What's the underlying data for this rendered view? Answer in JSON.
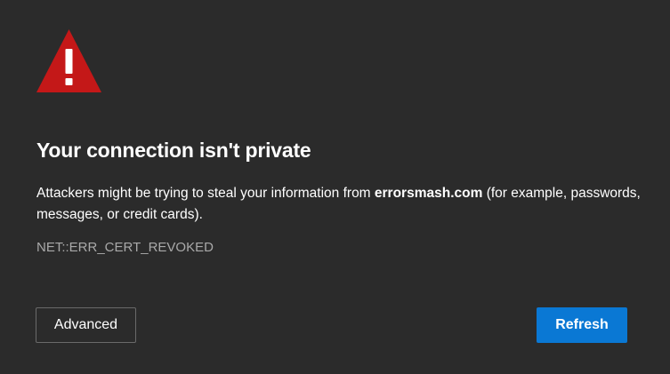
{
  "icon": {
    "name": "warning-triangle-icon",
    "color": "#c41818",
    "glyph_color": "#ffffff"
  },
  "title": "Your connection isn't private",
  "message": {
    "prefix": "Attackers might be trying to steal your information from ",
    "domain": "errorsmash.com",
    "suffix": " (for example, passwords, messages, or credit cards)."
  },
  "error_code": "NET::ERR_CERT_REVOKED",
  "buttons": {
    "advanced_label": "Advanced",
    "refresh_label": "Refresh"
  },
  "colors": {
    "background": "#2b2b2b",
    "accent": "#0a78d4",
    "muted_text": "#a9a9a9"
  }
}
